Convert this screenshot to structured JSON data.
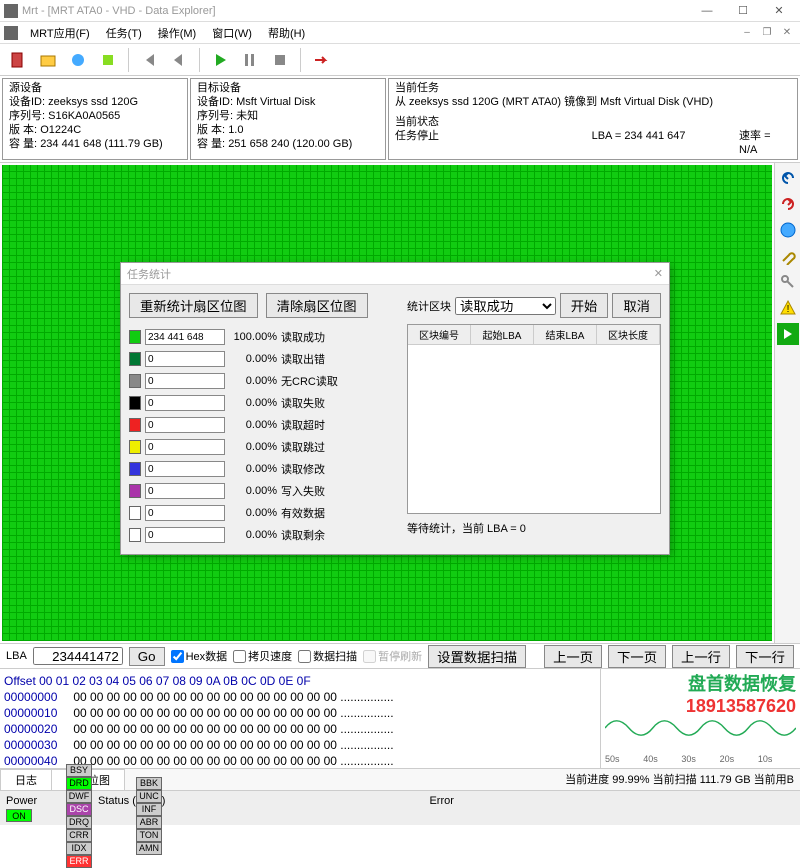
{
  "window": {
    "title": "Mrt - [MRT ATA0 - VHD - Data Explorer]"
  },
  "menu": {
    "app": "MRT应用(F)",
    "task": "任务(T)",
    "operate": "操作(M)",
    "window": "窗口(W)",
    "help": "帮助(H)"
  },
  "source": {
    "header": "源设备",
    "id_lbl": "设备ID:",
    "id": "zeeksys ssd 120G",
    "serial_lbl": "序列号:",
    "serial": "S16KA0A0565",
    "ver_lbl": "版 本:",
    "ver": "O1224C",
    "cap_lbl": "容 量:",
    "cap": "234 441 648 (111.79 GB)"
  },
  "target": {
    "header": "目标设备",
    "id_lbl": "设备ID:",
    "id": "Msft Virtual Disk",
    "serial_lbl": "序列号:",
    "serial": "未知",
    "ver_lbl": "版 本:",
    "ver": "1.0",
    "cap_lbl": "容 量:",
    "cap": "251 658 240 (120.00 GB)"
  },
  "task": {
    "header": "当前任务",
    "desc": "从 zeeksys ssd 120G (MRT ATA0) 镜像到 Msft Virtual Disk (VHD)",
    "state_hdr": "当前状态",
    "state": "任务停止",
    "lba_lbl": "LBA = 234 441 647",
    "rate_lbl": "速率 = N/A"
  },
  "dialog": {
    "title": "任务统计",
    "btn_recalc": "重新统计扇区位图",
    "btn_clear": "清除扇区位图",
    "block_lbl": "统计区块",
    "block_sel": "读取成功",
    "btn_start": "开始",
    "btn_cancel": "取消",
    "cols": {
      "c1": "区块编号",
      "c2": "起始LBA",
      "c3": "结束LBA",
      "c4": "区块长度"
    },
    "rows": [
      {
        "color": "#1c1",
        "val": "234 441 648",
        "pct": "100.00%",
        "lbl": "读取成功"
      },
      {
        "color": "#073",
        "val": "0",
        "pct": "0.00%",
        "lbl": "读取出错"
      },
      {
        "color": "#888",
        "val": "0",
        "pct": "0.00%",
        "lbl": "无CRC读取"
      },
      {
        "color": "#000",
        "val": "0",
        "pct": "0.00%",
        "lbl": "读取失败"
      },
      {
        "color": "#e22",
        "val": "0",
        "pct": "0.00%",
        "lbl": "读取超时"
      },
      {
        "color": "#ee0",
        "val": "0",
        "pct": "0.00%",
        "lbl": "读取跳过"
      },
      {
        "color": "#33d",
        "val": "0",
        "pct": "0.00%",
        "lbl": "读取修改"
      },
      {
        "color": "#a3a",
        "val": "0",
        "pct": "0.00%",
        "lbl": "写入失败"
      },
      {
        "color": "#fff",
        "val": "0",
        "pct": "0.00%",
        "lbl": "有效数据"
      },
      {
        "color": "#fff",
        "val": "0",
        "pct": "0.00%",
        "lbl": "读取剩余"
      }
    ],
    "footer": "等待统计，当前 LBA = 0"
  },
  "nav": {
    "lba_lbl": "LBA",
    "lba_val": "234441472",
    "go": "Go",
    "hex": "Hex数据",
    "copy": "拷贝速度",
    "scan": "数据扫描",
    "pause": "暂停刷新",
    "setscan": "设置数据扫描",
    "prev_page": "上一页",
    "next_page": "下一页",
    "prev_line": "上一行",
    "next_line": "下一行"
  },
  "hex": {
    "header": "Offset   00 01 02 03 04 05 06 07 08 09 0A 0B 0C 0D 0E 0F",
    "rows": [
      {
        "off": "00000000",
        "b": "00 00 00 00 00 00 00 00 00 00 00 00 00 00 00 00",
        "a": "................"
      },
      {
        "off": "00000010",
        "b": "00 00 00 00 00 00 00 00 00 00 00 00 00 00 00 00",
        "a": "................"
      },
      {
        "off": "00000020",
        "b": "00 00 00 00 00 00 00 00 00 00 00 00 00 00 00 00",
        "a": "................"
      },
      {
        "off": "00000030",
        "b": "00 00 00 00 00 00 00 00 00 00 00 00 00 00 00 00",
        "a": "................"
      },
      {
        "off": "00000040",
        "b": "00 00 00 00 00 00 00 00 00 00 00 00 00 00 00 00",
        "a": "................"
      }
    ]
  },
  "watermark": {
    "text": "盘首数据恢复",
    "phone": "18913587620"
  },
  "xaxis": [
    "50s",
    "40s",
    "30s",
    "20s",
    "10s"
  ],
  "tabs": {
    "log": "日志",
    "map": "扇区位图"
  },
  "progress": "当前进度 99.99% 当前扫描 111.79 GB 当前用B",
  "status": {
    "power": "Power",
    "status_lbl": "Status (ATA0)",
    "error_lbl": "Error",
    "status_leds": [
      "BSY",
      "DRD",
      "DWF",
      "DSC",
      "DRQ",
      "CRR",
      "IDX",
      "ERR"
    ],
    "error_leds": [
      "BBK",
      "UNC",
      "INF",
      "ABR",
      "TON",
      "AMN"
    ]
  }
}
